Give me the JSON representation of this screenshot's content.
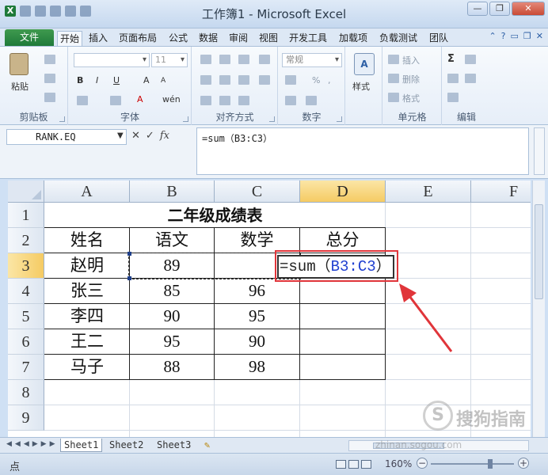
{
  "window": {
    "title": "工作簿1 - Microsoft Excel",
    "controls": {
      "minimize": "—",
      "restore": "❐",
      "close": "✕"
    }
  },
  "ribbon": {
    "tabs": [
      "文件",
      "开始",
      "插入",
      "页面布局",
      "公式",
      "数据",
      "审阅",
      "视图",
      "开发工具",
      "加载项",
      "负载测试",
      "团队"
    ],
    "active_tab": "开始",
    "clipboard": {
      "paste": "粘贴",
      "label": "剪贴板"
    },
    "font": {
      "size": "11",
      "label": "字体",
      "b": "B",
      "i": "I",
      "u": "U",
      "grow": "A",
      "shrink": "A",
      "font_color": "A",
      "wen": "wén"
    },
    "alignment": {
      "label": "对齐方式"
    },
    "number": {
      "format": "常规",
      "label": "数字",
      "percent": "%",
      "comma": ","
    },
    "styles": {
      "label": "样式"
    },
    "cells": {
      "insert": "插入",
      "delete": "删除",
      "format": "格式",
      "label": "单元格"
    },
    "editing": {
      "sum": "Σ",
      "label": "编辑"
    }
  },
  "formula_bar": {
    "name_box": "RANK.EQ",
    "cancel": "✕",
    "enter": "✓",
    "fx": "fx",
    "formula": "=sum（B3:C3）"
  },
  "columns": [
    "A",
    "B",
    "C",
    "D",
    "E",
    "F"
  ],
  "selected_column": "D",
  "rows": [
    "1",
    "2",
    "3",
    "4",
    "5",
    "6",
    "7",
    "8",
    "9"
  ],
  "selected_row": "3",
  "sheet": {
    "title": "二年级成绩表",
    "headers": [
      "姓名",
      "语文",
      "数学",
      "总分"
    ],
    "records": [
      {
        "name": "赵明",
        "chinese": "89",
        "math": "",
        "total": ""
      },
      {
        "name": "张三",
        "chinese": "85",
        "math": "96",
        "total": ""
      },
      {
        "name": "李四",
        "chinese": "90",
        "math": "95",
        "total": ""
      },
      {
        "name": "王二",
        "chinese": "95",
        "math": "90",
        "total": ""
      },
      {
        "name": "马子",
        "chinese": "88",
        "math": "98",
        "total": ""
      }
    ],
    "editing_formula": {
      "prefix": "=sum（",
      "ref": "B3:C3",
      "suffix": "）"
    }
  },
  "sheet_tabs": [
    "Sheet1",
    "Sheet2",
    "Sheet3"
  ],
  "active_sheet": "Sheet1",
  "status_bar": {
    "mode": "点",
    "zoom": "160%"
  },
  "watermark": {
    "brand": "搜狗指南",
    "url": "zhinan.sogou.com"
  },
  "colors": {
    "accent_green": "#1f7a3a",
    "highlight": "#f5cb63",
    "annotation_red": "#e0353a",
    "ref_blue": "#1f3fd0"
  }
}
